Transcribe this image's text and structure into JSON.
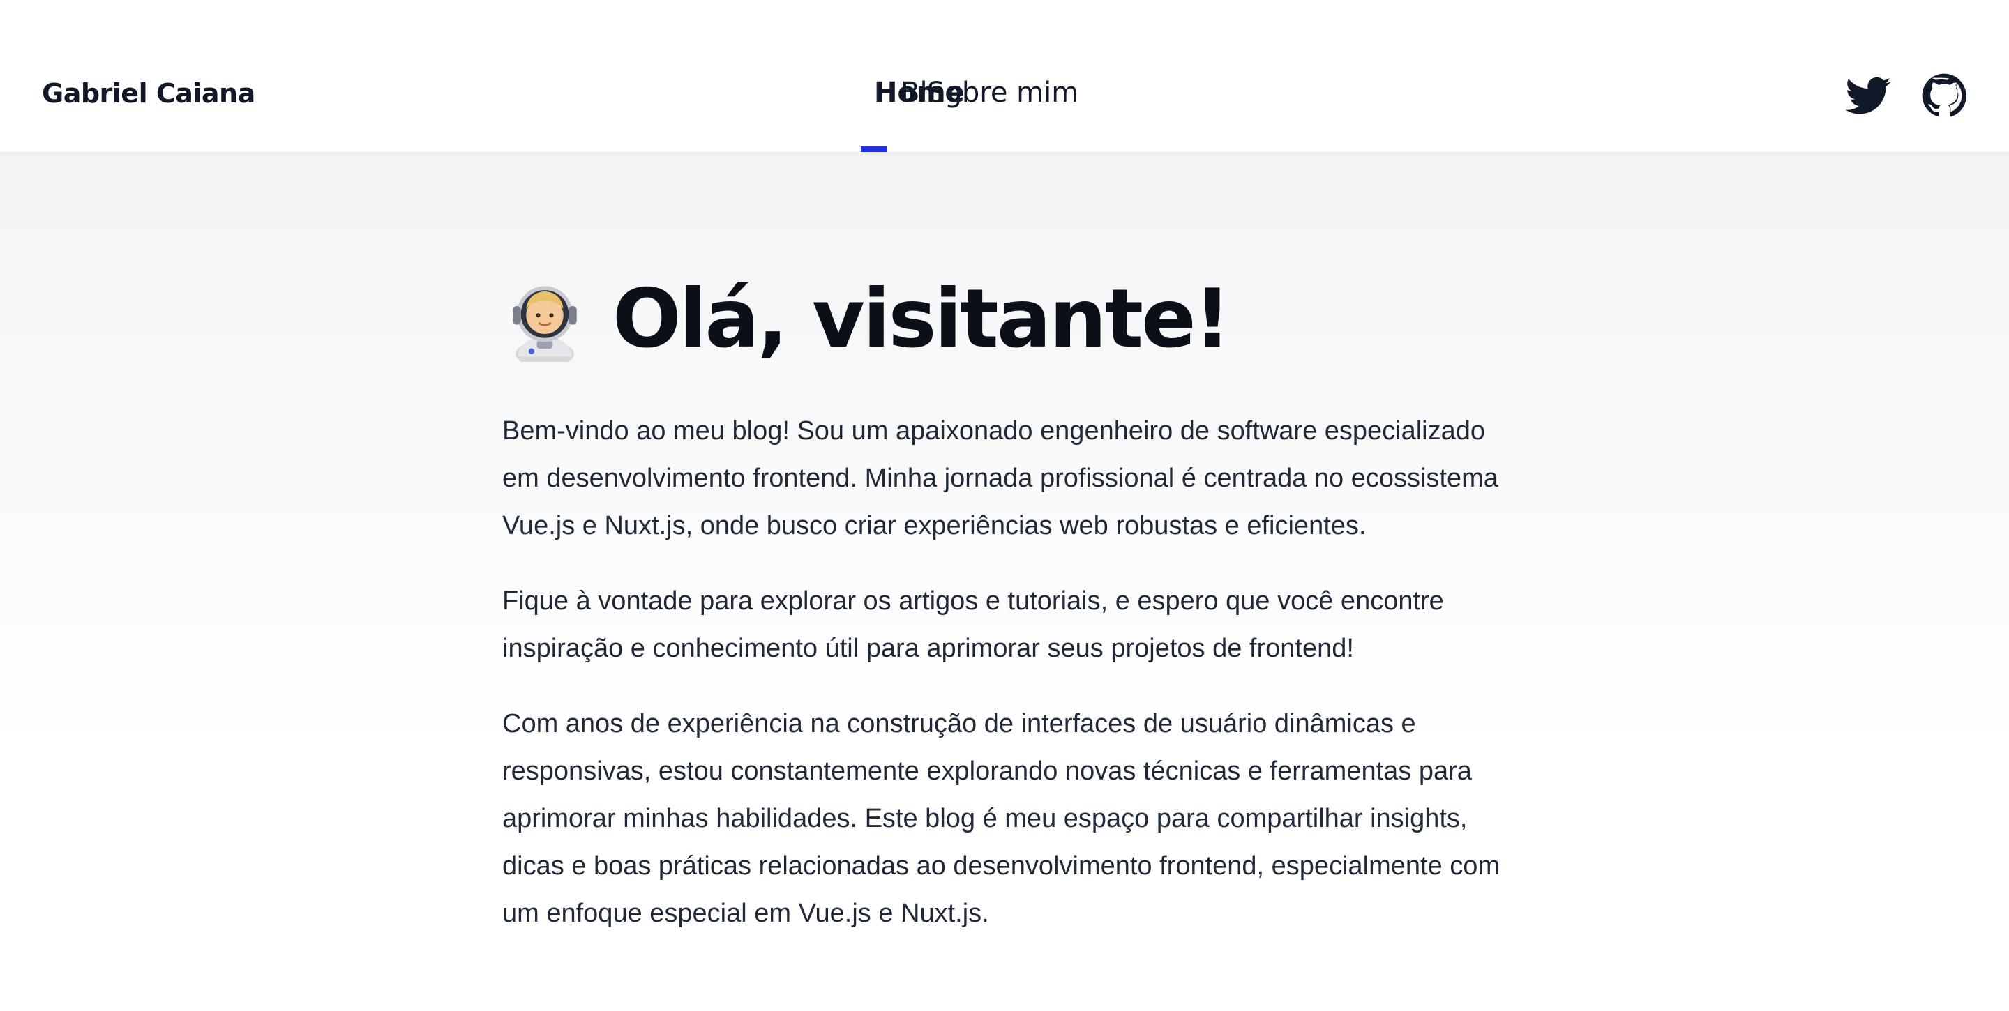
{
  "header": {
    "brand": "Gabriel Caiana",
    "nav": [
      {
        "label": "Home",
        "active": true
      },
      {
        "label": "Blog",
        "active": false
      },
      {
        "label": "Sobre mim",
        "active": false
      }
    ],
    "socials": [
      {
        "icon": "twitter-icon"
      },
      {
        "icon": "github-icon"
      }
    ],
    "accent_color": "#2230e6"
  },
  "main": {
    "emoji_icon": "astronaut-icon",
    "title": "Olá, visitante!",
    "paragraphs": [
      "Bem-vindo ao meu blog! Sou um apaixonado engenheiro de software especializado em desenvolvimento frontend. Minha jornada profissional é centrada no ecossistema Vue.js e Nuxt.js, onde busco criar experiências web robustas e eficientes.",
      "Fique à vontade para explorar os artigos e tutoriais, e espero que você encontre inspiração e conhecimento útil para aprimorar seus projetos de frontend!",
      "Com anos de experiência na construção de interfaces de usuário dinâmicas e responsivas, estou constantemente explorando novas técnicas e ferramentas para aprimorar minhas habilidades. Este blog é meu espaço para compartilhar insights, dicas e boas práticas relacionadas ao desenvolvimento frontend, especialmente com um enfoque especial em Vue.js e Nuxt.js."
    ]
  }
}
